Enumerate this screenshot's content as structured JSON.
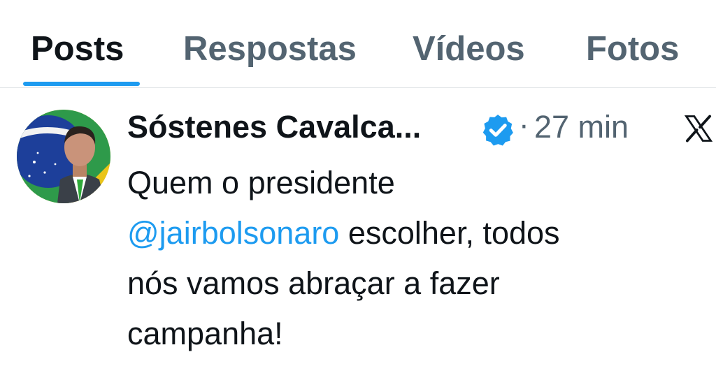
{
  "tabs": [
    {
      "label": "Posts",
      "active": true
    },
    {
      "label": "Respostas",
      "active": false
    },
    {
      "label": "Vídeos",
      "active": false
    },
    {
      "label": "Fotos",
      "active": false
    }
  ],
  "colors": {
    "accent": "#1d9bf0",
    "text_primary": "#0f1419",
    "text_secondary": "#536471"
  },
  "post": {
    "author_name": "Sóstenes Cavalca...",
    "separator": "·",
    "timestamp": "27 min",
    "verified_icon": "verified-badge-icon",
    "platform_icon": "x-logo-icon",
    "avatar_icon": "avatar",
    "text": {
      "line1": "Quem o presidente",
      "mention": "@jairbolsonaro",
      "line2_rest": " escolher, todos",
      "line3": "nós vamos abraçar a fazer",
      "line4": "campanha!"
    }
  }
}
